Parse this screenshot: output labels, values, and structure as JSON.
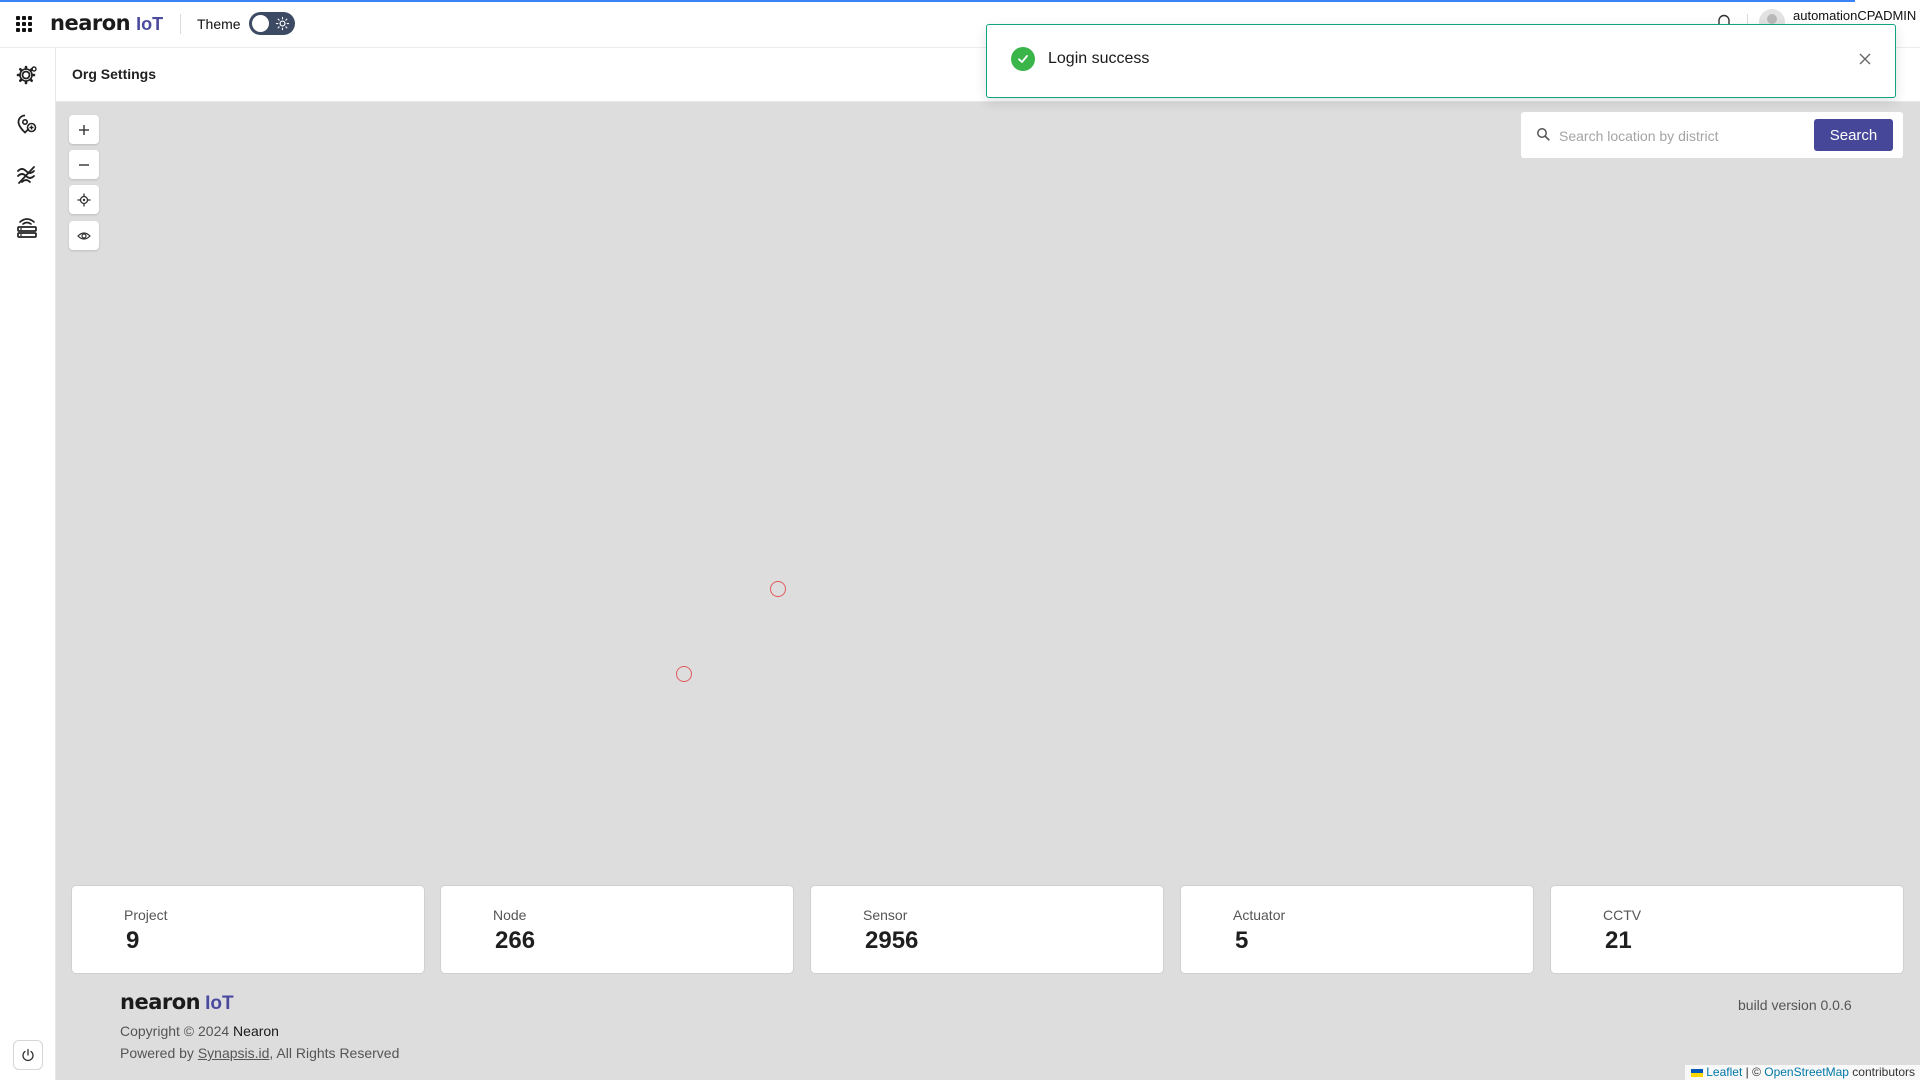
{
  "topbar": {
    "logo_word": "nearon",
    "logo_iot": "IoT",
    "theme_label": "Theme",
    "username": "automationCPADMIN"
  },
  "header": {
    "title": "Org Settings"
  },
  "toast": {
    "message": "Login success"
  },
  "search": {
    "placeholder": "Search location by district",
    "value": "",
    "button_label": "Search"
  },
  "map_controls": {
    "zoom_in": "+",
    "zoom_out": "−"
  },
  "stats": [
    {
      "label": "Project",
      "value": "9"
    },
    {
      "label": "Node",
      "value": "266"
    },
    {
      "label": "Sensor",
      "value": "2956"
    },
    {
      "label": "Actuator",
      "value": "5"
    },
    {
      "label": "CCTV",
      "value": "21"
    }
  ],
  "footer": {
    "logo_word": "nearon",
    "logo_iot": "IoT",
    "copyright_prefix": "Copyright © 2024",
    "copyright_brand": "Nearon",
    "powered_prefix": "Powered by",
    "powered_link": "Synapsis.id",
    "powered_suffix": ", All Rights Reserved",
    "build_version": "build version 0.0.6"
  },
  "attribution": {
    "leaflet": "Leaflet",
    "separator": " | © ",
    "osm": "OpenStreetMap",
    "suffix": " contributors"
  },
  "colors": {
    "accent": "#47479a",
    "brand_iot": "#4b4a9e",
    "toast_border": "#10a37f",
    "success": "#39b54a",
    "marker": "#e0595b",
    "map_bg": "#dddddd"
  },
  "icons": {
    "sidebar": [
      "settings-gear-icon",
      "location-pin-icon",
      "signal-waves-icon",
      "router-icon"
    ],
    "map_controls": [
      "plus-icon",
      "minus-icon",
      "locate-icon",
      "eye-icon"
    ]
  }
}
